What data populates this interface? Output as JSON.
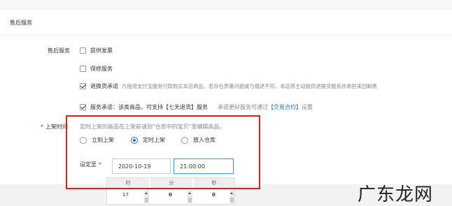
{
  "section": {
    "title": "售后服务"
  },
  "after_sales": {
    "label": "售后服务",
    "options": [
      {
        "label": "提供发票",
        "checked": false
      },
      {
        "label": "保修服务",
        "checked": false
      },
      {
        "label": "退换货承诺",
        "desc": "凡使用支付宝服务付款购买本店商品，若存在质量问题或与描述不符，本店将主动提供退换货服务并承担来回邮费",
        "checked": true
      },
      {
        "label": "服务承诺：该类商品，可支持【七天退货】服务",
        "desc_before": "承诺更好服务可通过",
        "link": "【交易合约】",
        "desc_after": "设置",
        "checked": true
      }
    ]
  },
  "listing_time": {
    "required_mark": "*",
    "label": "上架时间",
    "hint": "定时上架的商品在上架前请到\"仓库中的宝贝\"里编辑商品。",
    "radios": [
      {
        "label": "立刻上架",
        "selected": false
      },
      {
        "label": "定时上架",
        "selected": true
      },
      {
        "label": "放入仓库",
        "selected": false
      }
    ],
    "set_to_label": "设定至",
    "date_value": "2020-10-19",
    "time_value": "21:00:00"
  },
  "time_picker": {
    "headers": [
      "时",
      "分",
      "秒"
    ],
    "values": [
      "17",
      "0",
      "0"
    ]
  },
  "watermark": {
    "text": "广东龙网"
  },
  "colors": {
    "highlight": "#e0201c",
    "link": "#2a6fc9",
    "required": "#e0201c"
  }
}
